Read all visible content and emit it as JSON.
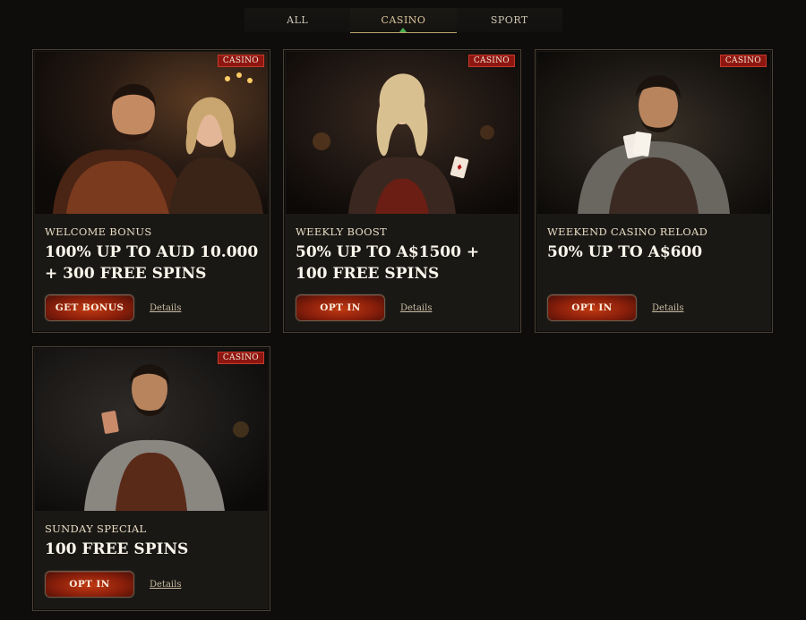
{
  "tabs": [
    {
      "label": "ALL",
      "active": false
    },
    {
      "label": "CASINO",
      "active": true
    },
    {
      "label": "SPORT",
      "active": false
    }
  ],
  "cards": [
    {
      "badge": "CASINO",
      "kicker": "WELCOME BONUS",
      "headline": "100% UP TO AUD 10.000 + 300 FREE SPINS",
      "button": "GET BONUS",
      "details": "Details",
      "image": "royal-couple-illustration"
    },
    {
      "badge": "CASINO",
      "kicker": "WEEKLY BOOST",
      "headline": "50% UP TO A$1500 + 100 FREE SPINS",
      "button": "OPT IN",
      "details": "Details",
      "image": "queen-with-card-illustration"
    },
    {
      "badge": "CASINO",
      "kicker": "WEEKEND CASINO RELOAD",
      "headline": "50% UP TO A$600",
      "button": "OPT IN",
      "details": "Details",
      "image": "nobleman-with-cards-illustration"
    },
    {
      "badge": "CASINO",
      "kicker": "SUNDAY SPECIAL",
      "headline": "100 FREE SPINS",
      "button": "OPT IN",
      "details": "Details",
      "image": "king-with-card-illustration"
    }
  ],
  "colors": {
    "background": "#0e0d0b",
    "card": "#1a1815",
    "badge": "#8e1610",
    "button": "#a92d0f",
    "active_tab_caret": "#4caf50"
  }
}
